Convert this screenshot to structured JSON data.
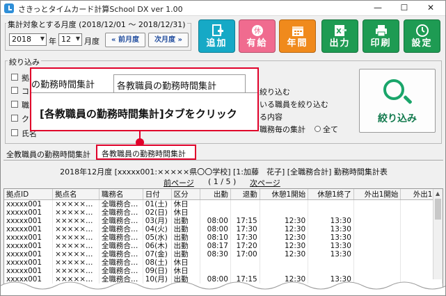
{
  "window": {
    "title": "さきっとタイムカード計算School DX  ver 1.00",
    "minimize": "—",
    "maximize": "☐",
    "close": "✕"
  },
  "period": {
    "legend": "集計対象とする月度 (2018/12/01 〜 2018/12/31)",
    "year": "2018",
    "year_unit": "年",
    "month": "12",
    "month_unit": "月度",
    "prev": "« 前月度",
    "next": "次月度 »"
  },
  "toolbar": [
    {
      "label": "追加",
      "color": "#16a9c6",
      "icon": "add-document-icon"
    },
    {
      "label": "有給",
      "color": "#f06b8f",
      "icon": "paid-leave-icon"
    },
    {
      "label": "年間",
      "color": "#f08a1c",
      "icon": "calendar-icon"
    },
    {
      "label": "出力",
      "color": "#1e9b53",
      "icon": "export-icon"
    },
    {
      "label": "印刷",
      "color": "#1e9b53",
      "icon": "printer-icon"
    },
    {
      "label": "設定",
      "color": "#1e9b53",
      "icon": "clock-settings-icon"
    }
  ],
  "filter": {
    "legend": "絞り込み",
    "checkboxes": [
      "拠",
      "コ",
      "職",
      "ク",
      "氏名"
    ],
    "right_texts": [
      "絞り込む",
      "いる職員を絞り込む",
      "る内容",
      "職務毎の集計"
    ],
    "radio_all": "全て",
    "button_label": "絞り込み"
  },
  "callout": {
    "tab1": "の勤務時間集計",
    "tab2": "各教職員の勤務時間集計",
    "instruction": "[各教職員の勤務時間集計]タブをクリック"
  },
  "tabs": {
    "tab1": "全教職員の勤務時間集計",
    "tab2": "各教職員の勤務時間集計"
  },
  "report": {
    "title": "2018年12月度 [xxxxx001:×××××県〇〇学校] [1:加藤　花子] [全職務合計] 勤務時間集計表",
    "prev_page": "前ページ",
    "page_info": "( 1 / 5 )",
    "next_page": "次ページ"
  },
  "table": {
    "headers": [
      "拠点ID",
      "拠点名",
      "職務名",
      "日付",
      "区分",
      "出勤",
      "退勤",
      "休憩1開始",
      "休憩1終了",
      "外出1開始",
      "外出1終"
    ],
    "rows": [
      [
        "xxxxx001",
        "×××××…",
        "全職務合…",
        "01(土)",
        "休日",
        "",
        "",
        "",
        "",
        "",
        ""
      ],
      [
        "xxxxx001",
        "×××××…",
        "全職務合…",
        "02(日)",
        "休日",
        "",
        "",
        "",
        "",
        "",
        ""
      ],
      [
        "xxxxx001",
        "×××××…",
        "全職務合…",
        "03(月)",
        "出勤",
        "08:00",
        "17:15",
        "12:30",
        "13:30",
        "",
        ""
      ],
      [
        "xxxxx001",
        "×××××…",
        "全職務合…",
        "04(火)",
        "出勤",
        "08:00",
        "17:30",
        "12:30",
        "13:30",
        "",
        ""
      ],
      [
        "xxxxx001",
        "×××××…",
        "全職務合…",
        "05(水)",
        "出勤",
        "08:10",
        "17:30",
        "12:30",
        "13:30",
        "",
        ""
      ],
      [
        "xxxxx001",
        "×××××…",
        "全職務合…",
        "06(木)",
        "出勤",
        "08:17",
        "17:20",
        "12:30",
        "13:30",
        "",
        ""
      ],
      [
        "xxxxx001",
        "×××××…",
        "全職務合…",
        "07(金)",
        "出勤",
        "08:30",
        "17:00",
        "12:30",
        "13:30",
        "",
        ""
      ],
      [
        "xxxxx001",
        "×××××…",
        "全職務合…",
        "08(土)",
        "休日",
        "",
        "",
        "",
        "",
        "",
        ""
      ],
      [
        "xxxxx001",
        "×××××…",
        "全職務合…",
        "09(日)",
        "休日",
        "",
        "",
        "",
        "",
        "",
        ""
      ],
      [
        "xxxxx001",
        "×××××…",
        "全職務合…",
        "10(月)",
        "出勤",
        "08:00",
        "17:15",
        "12:30",
        "13:30",
        "",
        ""
      ]
    ]
  }
}
